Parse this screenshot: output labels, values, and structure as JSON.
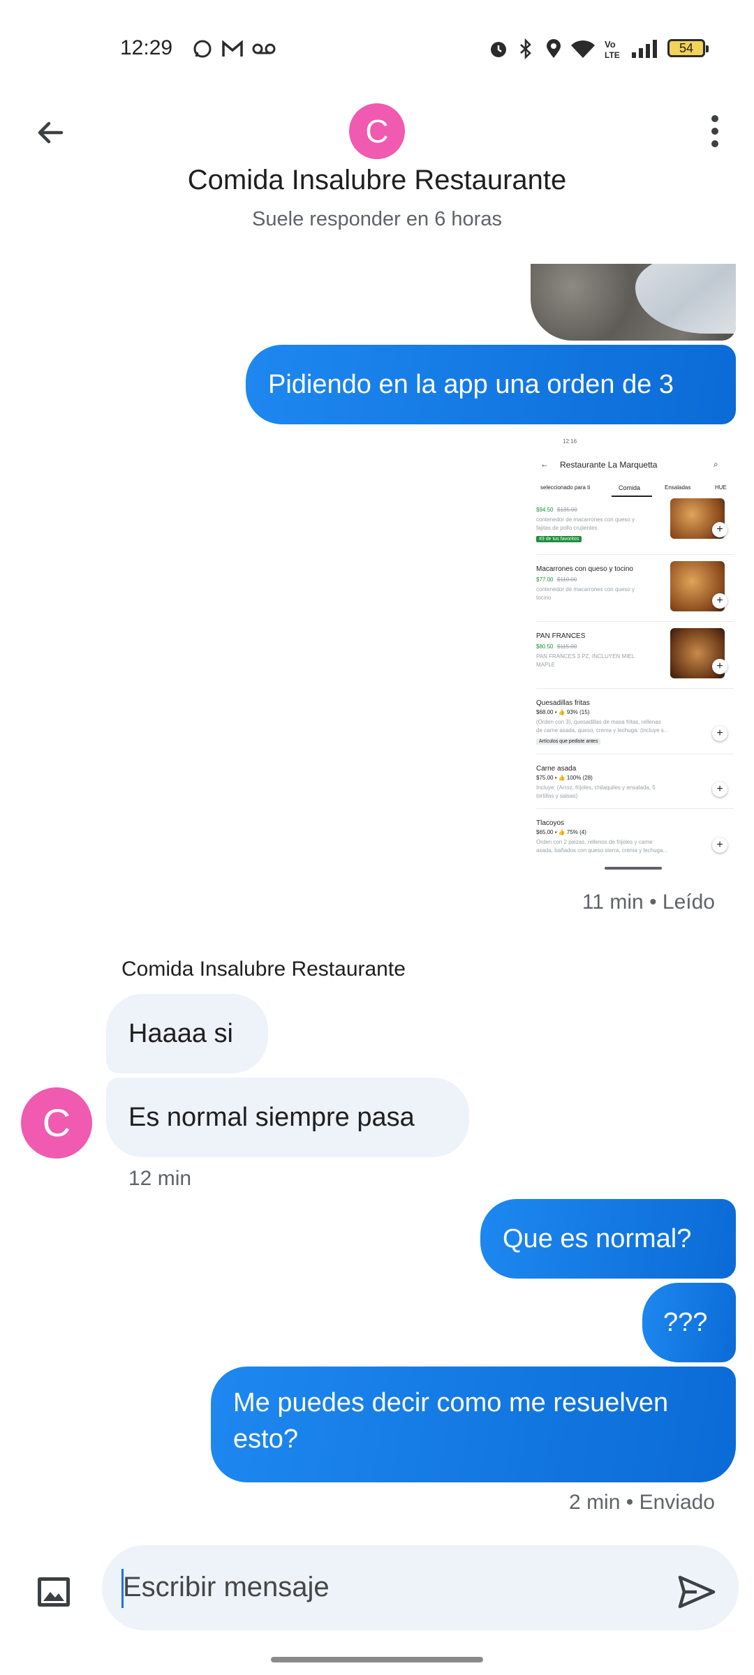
{
  "status_bar": {
    "time": "12:29",
    "battery": "54"
  },
  "header": {
    "avatar_letter": "C",
    "title": "Comida Insalubre Restaurante",
    "subtitle": "Suele responder en 6 horas"
  },
  "messages": {
    "out_1": "Pidiendo en la app una orden de 3",
    "image_meta": "11 min • Leído",
    "sender_name": "Comida Insalubre Restaurante",
    "in_1": "Haaaa si",
    "in_2": "Es normal siempre pasa",
    "in_avatar_letter": "C",
    "in_time": "12 min",
    "out_2": "Que es normal?",
    "out_3": "???",
    "out_4": "Me puedes decir como me resuelven esto?",
    "out_meta": "2 min • Enviado"
  },
  "attached_screenshot": {
    "time": "12:16",
    "title": "Restaurante La Marquetta",
    "tabs": [
      "seleccionado para ti",
      "Comida",
      "Ensaladas",
      "HUE"
    ],
    "items": [
      {
        "price": "$94.50",
        "old_price": "$135.00",
        "desc": "contenedor de macarrones con queso y",
        "desc2": "fajitas de pollo crujientes",
        "badge": "#3 de tus favoritos"
      },
      {
        "name": "Macarrones con queso y tocino",
        "price": "$77.00",
        "old_price": "$110.00",
        "desc": "contenedor de macarrones con queso y",
        "desc2": "tocino"
      },
      {
        "name": "PAN FRANCES",
        "price": "$80.50",
        "old_price": "$115.00",
        "desc": "PAN FRANCES 3 PZ, INCLUYEN MIEL",
        "desc2": "MAPLE"
      },
      {
        "name": "Quesadillas fritas",
        "price": "$68.00 • 👍 93% (15)",
        "desc": "(Orden con 3), quesadillas de masa fritas, rellenas",
        "desc2": "de carne asada, queso, crema y lechuga. (incluye s...",
        "badge": "Artículos que pediste antes"
      },
      {
        "name": "Carne asada",
        "price": "$75.00 • 👍 100% (28)",
        "desc": "Incluye: (Arroz, frijoles, chilaquiles y ensalada, 5",
        "desc2": "tortillas y salsas)"
      },
      {
        "name": "Tlacoyos",
        "price": "$65.00 • 👍 75% (4)",
        "desc": "Orden con 2 piezas, rellenos de frijoles y carne",
        "desc2": "asada, bañados con queso sierra, crema y lechuga..."
      }
    ]
  },
  "composer": {
    "placeholder": "Escribir mensaje"
  },
  "icons": [
    "whatsapp-icon",
    "gmail-icon",
    "voicemail-icon",
    "alarm-icon",
    "bluetooth-icon",
    "location-icon",
    "wifi-icon",
    "volte-icon",
    "signal-icon",
    "back-arrow-icon",
    "more-vert-icon",
    "gallery-icon",
    "send-icon"
  ]
}
